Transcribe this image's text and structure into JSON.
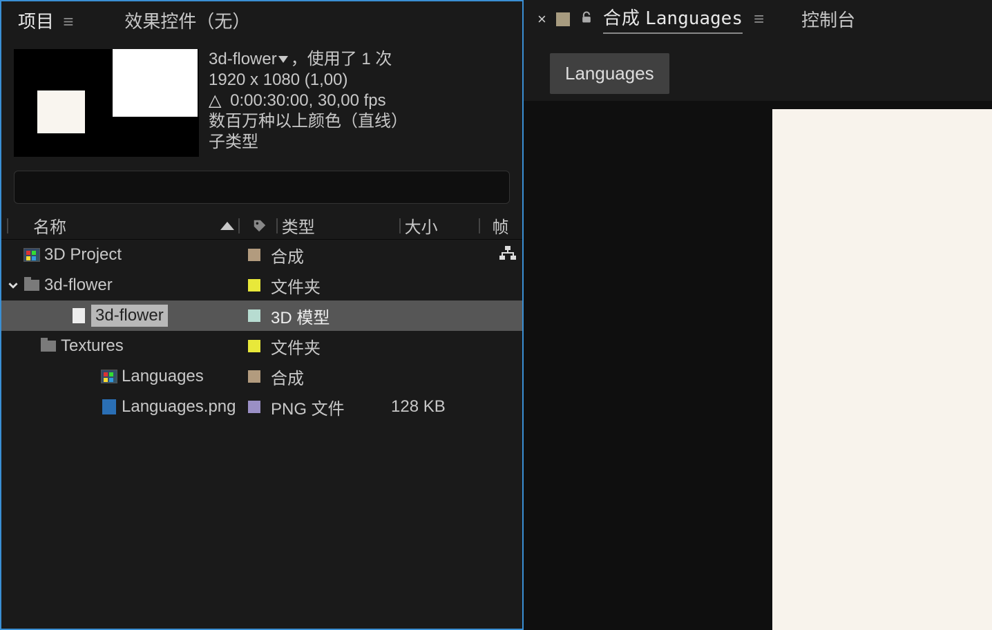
{
  "left": {
    "tabs": {
      "project": "项目",
      "effectControls": "效果控件（无）"
    },
    "info": {
      "name": "3d-flower",
      "usage": "，使用了 1 次",
      "dimensions": "1920 x 1080 (1,00)",
      "duration": "0:00:30:00, 30,00 fps",
      "colorDepth": "数百万种以上颜色（直线）",
      "subtype": "子类型"
    },
    "search": {
      "placeholder": ""
    },
    "columns": {
      "name": "名称",
      "type": "类型",
      "size": "大小",
      "fps": "帧"
    },
    "rows": [
      {
        "indent": 1,
        "chevron": "",
        "icon": "comp",
        "name": "3D Project",
        "tag": "tan",
        "type": "合成",
        "size": "",
        "extraIcon": "flow",
        "selected": false
      },
      {
        "indent": 1,
        "chevron": "down",
        "icon": "folder",
        "name": "3d-flower",
        "tag": "yellow",
        "type": "文件夹",
        "size": "",
        "selected": false
      },
      {
        "indent": 3,
        "chevron": "",
        "icon": "doc",
        "name": "3d-flower",
        "tag": "pale",
        "type": "3D 模型",
        "size": "",
        "selected": true
      },
      {
        "indent": 2,
        "chevron": "down",
        "icon": "folder",
        "name": "Textures",
        "tag": "yellow",
        "type": "文件夹",
        "size": "",
        "selected": false
      },
      {
        "indent": 4,
        "chevron": "",
        "icon": "comp",
        "name": "Languages",
        "tag": "tan",
        "type": "合成",
        "size": "",
        "selected": false
      },
      {
        "indent": 4,
        "chevron": "",
        "icon": "png",
        "name": "Languages.png",
        "tag": "purple",
        "type": "PNG 文件",
        "size": "128 KB",
        "selected": false
      }
    ]
  },
  "right": {
    "titlePrefix": "合成",
    "titleName": "Languages",
    "console": "控制台",
    "tag": "Languages"
  }
}
